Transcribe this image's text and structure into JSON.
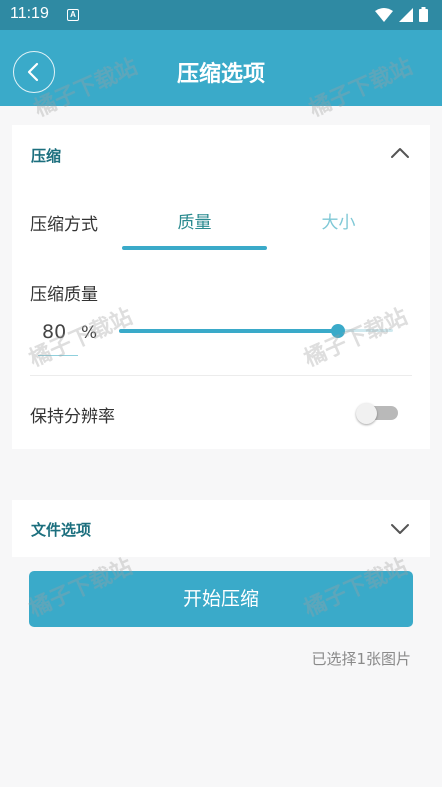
{
  "status_bar": {
    "time": "11:19",
    "notification_icon_letter": "A"
  },
  "app_bar": {
    "title": "压缩选项",
    "back_icon": "chevron-left-icon"
  },
  "compression_section": {
    "title": "压缩",
    "collapse_icon": "chevron-up-icon",
    "mode_label": "压缩方式",
    "tabs": [
      {
        "label": "质量",
        "selected": true
      },
      {
        "label": "大小",
        "selected": false
      }
    ],
    "quality_label": "压缩质量",
    "quality_value": "80",
    "quality_unit": "%",
    "slider_fraction": 0.8,
    "keep_resolution_label": "保持分辨率",
    "keep_resolution_on": false
  },
  "file_options_section": {
    "title": "文件选项",
    "expand_icon": "chevron-down-icon"
  },
  "start_button_label": "开始压缩",
  "selected_info": "已选择1张图片",
  "watermark_text": "橘子下载站",
  "colors": {
    "accent": "#3aaac9",
    "status_bar": "#2f8aa3",
    "section_title": "#1c6f7e"
  }
}
